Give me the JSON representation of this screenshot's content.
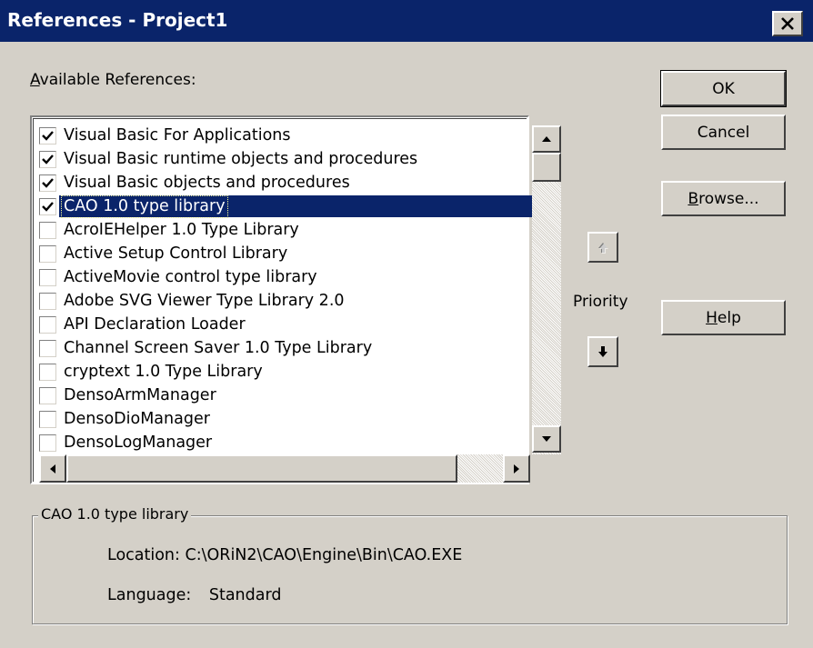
{
  "window": {
    "title": "References - Project1",
    "close_glyph": "✕"
  },
  "available_label": {
    "underlined": "A",
    "rest": "vailable References:"
  },
  "references": [
    {
      "label": "Visual Basic For Applications",
      "checked": true
    },
    {
      "label": "Visual Basic runtime objects and procedures",
      "checked": true
    },
    {
      "label": "Visual Basic objects and procedures",
      "checked": true
    },
    {
      "label": "CAO 1.0 type library",
      "checked": true,
      "selected": true
    },
    {
      "label": "AcroIEHelper 1.0 Type Library",
      "checked": false
    },
    {
      "label": "Active Setup Control Library",
      "checked": false
    },
    {
      "label": "ActiveMovie control type library",
      "checked": false
    },
    {
      "label": "Adobe SVG Viewer Type Library 2.0",
      "checked": false
    },
    {
      "label": "API Declaration Loader",
      "checked": false
    },
    {
      "label": "Channel Screen Saver 1.0 Type Library",
      "checked": false
    },
    {
      "label": "cryptext 1.0 Type Library",
      "checked": false
    },
    {
      "label": "DensoArmManager",
      "checked": false
    },
    {
      "label": "DensoDioManager",
      "checked": false
    },
    {
      "label": "DensoLogManager",
      "checked": false
    }
  ],
  "buttons": {
    "ok": "OK",
    "cancel": "Cancel",
    "browse": {
      "underlined": "B",
      "rest": "rowse..."
    },
    "help": {
      "underlined": "H",
      "rest": "elp"
    }
  },
  "priority": {
    "label": "Priority",
    "up_icon": "arrow-up-icon",
    "down_icon": "arrow-down-icon"
  },
  "details": {
    "group_title": "CAO 1.0 type library",
    "location_label": "Location:",
    "location_value": "C:\\ORiN2\\CAO\\Engine\\Bin\\CAO.EXE",
    "language_label": "Language:",
    "language_value": "Standard"
  },
  "colors": {
    "titlebar": "#0a246a",
    "face": "#d4d0c8",
    "selection": "#0a246a"
  }
}
